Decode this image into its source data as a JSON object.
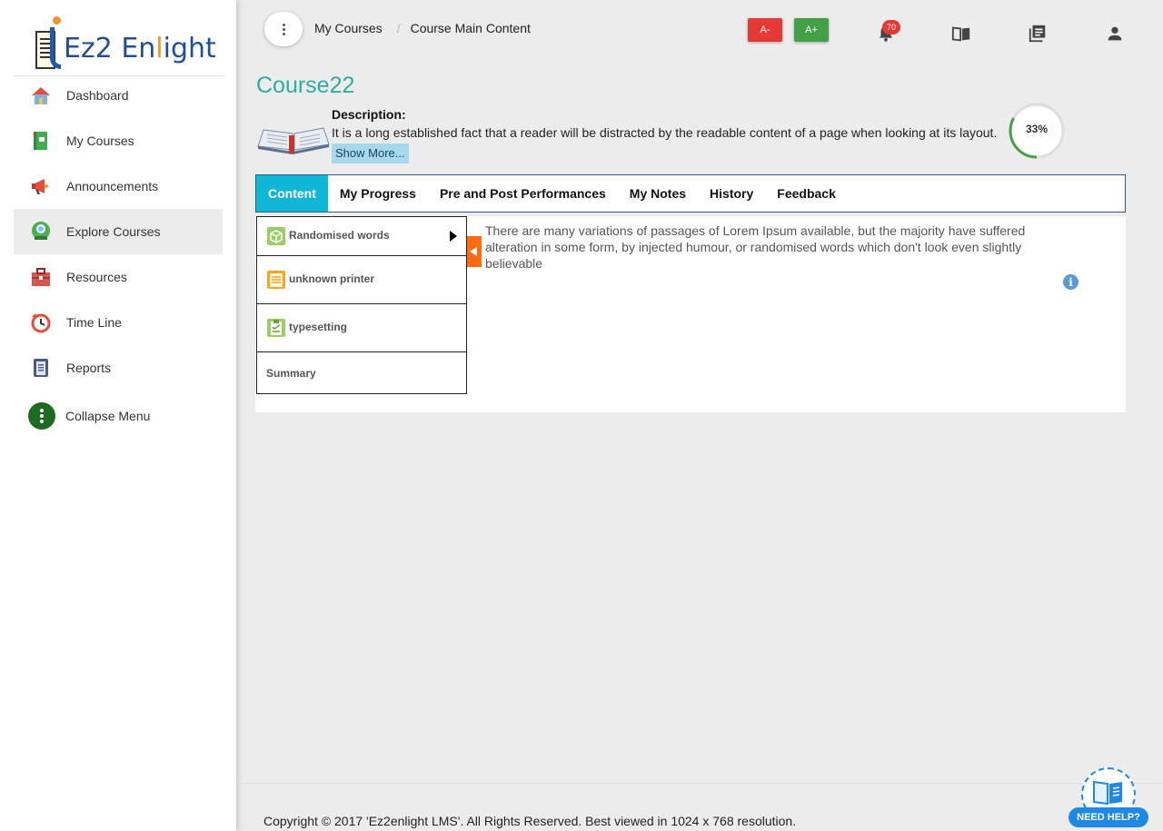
{
  "brand": {
    "name_prefix": "Ez2 En",
    "name_accent": "l",
    "name_suffix": "ight"
  },
  "sidebar": {
    "items": [
      {
        "label": "Dashboard",
        "icon": "home-icon"
      },
      {
        "label": "My Courses",
        "icon": "book-icon"
      },
      {
        "label": "Announcements",
        "icon": "megaphone-icon"
      },
      {
        "label": "Explore Courses",
        "icon": "explore-icon",
        "active": true
      },
      {
        "label": "Resources",
        "icon": "toolbox-icon"
      },
      {
        "label": "Time Line",
        "icon": "clock-icon"
      },
      {
        "label": "Reports",
        "icon": "report-icon"
      }
    ],
    "collapse_label": "Collapse Menu"
  },
  "header": {
    "breadcrumb": [
      "My Courses",
      "Course Main Content"
    ],
    "font_decrease": "A-",
    "font_increase": "A+",
    "notification_count": "70"
  },
  "course": {
    "title": "Course22",
    "description_label": "Description:",
    "description": "It is a long established fact that a reader will be distracted by the readable content of a page when looking at its layout.",
    "show_more": "Show More...",
    "progress_text": "33%",
    "progress_value": 0.33
  },
  "tabs": [
    "Content",
    "My Progress",
    "Pre and Post Performances",
    "My Notes",
    "History",
    "Feedback"
  ],
  "topics": [
    {
      "label": "Randomised words",
      "icon": "cube-icon"
    },
    {
      "label": "unknown printer",
      "icon": "checklist-icon"
    },
    {
      "label": "typesetting",
      "icon": "clipboard-icon"
    },
    {
      "label": "Summary"
    }
  ],
  "content_text": "There are many variations of passages of Lorem Ipsum available, but the majority have suffered alteration in some form, by injected humour, or randomised words which don't look even slightly believable",
  "footer": "Copyright © 2017 'Ez2enlight LMS'. All Rights Reserved. Best viewed in 1024 x 768 resolution.",
  "help_label": "NEED HELP?",
  "colors": {
    "accent": "#0fb6d6",
    "title": "#2bafa1",
    "progress": "#43a047",
    "danger": "#e53935",
    "success": "#43a047",
    "toggle": "#ff6a13"
  }
}
